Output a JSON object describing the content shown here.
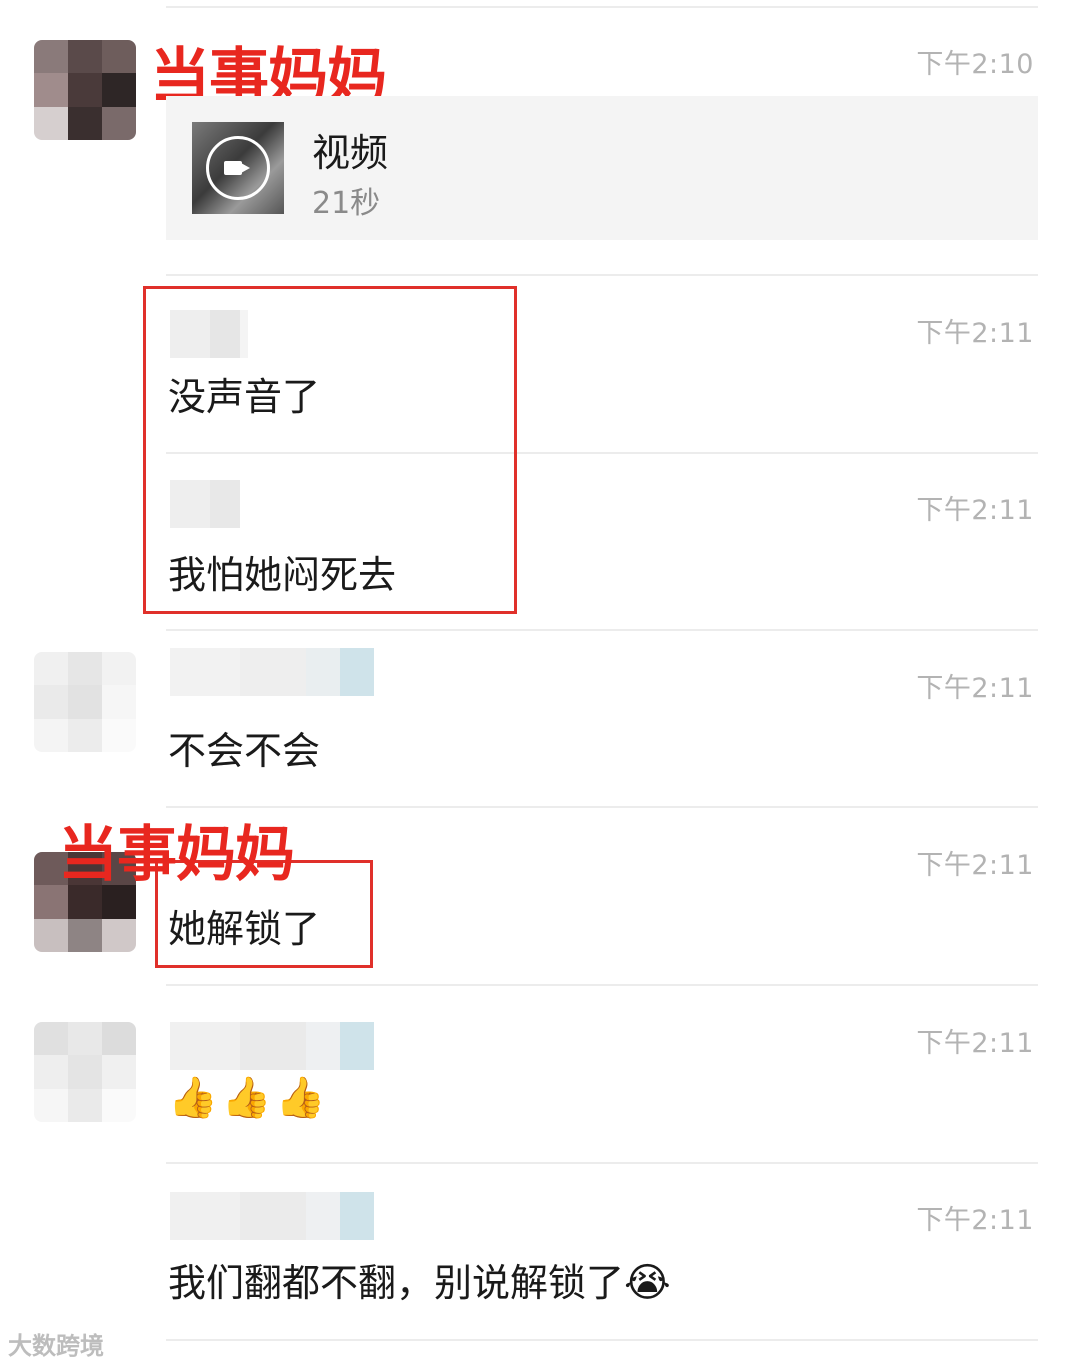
{
  "labels": {
    "mother_top": "当事妈妈",
    "mother_bottom": "当事妈妈"
  },
  "video": {
    "title": "视频",
    "duration": "21秒",
    "icon": "video-camera-icon"
  },
  "messages": [
    {
      "time": "下午2:10"
    },
    {
      "time": "下午2:11",
      "text": "没声音了"
    },
    {
      "time": "下午2:11",
      "text": "我怕她闷死去"
    },
    {
      "time": "下午2:11",
      "text": "不会不会"
    },
    {
      "time": "下午2:11",
      "text": "她解锁了"
    },
    {
      "time": "下午2:11",
      "emoji": [
        "👍",
        "👍",
        "👍"
      ]
    },
    {
      "time": "下午2:11",
      "text": "我们翻都不翻，别说解锁了",
      "emoji": "😭"
    }
  ],
  "watermark": "大数跨境",
  "colors": {
    "accent_red": "#e8271f",
    "timestamp": "#b3b3b3"
  }
}
